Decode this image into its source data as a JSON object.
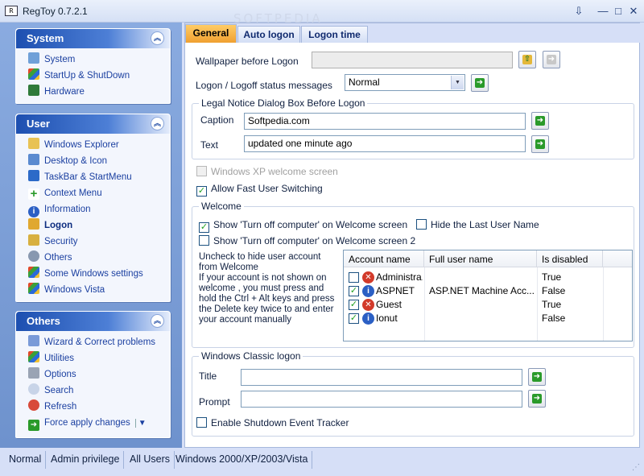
{
  "window": {
    "title": "RegToy 0.7.2.1",
    "watermark": "SOFTPEDIA"
  },
  "sidebar": {
    "system": {
      "title": "System",
      "items": [
        {
          "label": "System",
          "icon": "computer-icon"
        },
        {
          "label": "StartUp & ShutDown",
          "icon": "windows-flag-icon"
        },
        {
          "label": "Hardware",
          "icon": "circuit-board-icon"
        }
      ]
    },
    "user": {
      "title": "User",
      "items": [
        {
          "label": "Windows Explorer",
          "icon": "folder-icon"
        },
        {
          "label": "Desktop & Icon",
          "icon": "desktop-icon"
        },
        {
          "label": "TaskBar & StartMenu",
          "icon": "taskbar-icon"
        },
        {
          "label": "Context Menu",
          "icon": "plus-icon"
        },
        {
          "label": "Information",
          "icon": "info-icon"
        },
        {
          "label": "Logon",
          "icon": "key-icon"
        },
        {
          "label": "Security",
          "icon": "lock-icon"
        },
        {
          "label": "Others",
          "icon": "gear-icon"
        },
        {
          "label": "Some Windows settings",
          "icon": "windows-logo-icon"
        },
        {
          "label": "Windows Vista",
          "icon": "vista-logo-icon"
        }
      ]
    },
    "others": {
      "title": "Others",
      "items": [
        {
          "label": "Wizard & Correct problems",
          "icon": "wizard-icon"
        },
        {
          "label": "Utilities",
          "icon": "utilities-icon"
        },
        {
          "label": "Options",
          "icon": "tools-icon"
        },
        {
          "label": "Search",
          "icon": "magnifier-icon"
        },
        {
          "label": "Refresh",
          "icon": "refresh-icon"
        },
        {
          "label": "Force apply changes",
          "icon": "arrow-right-icon"
        }
      ]
    }
  },
  "tabs": [
    "General",
    "Auto logon",
    "Logon time"
  ],
  "general": {
    "wallpaper_label": "Wallpaper before Logon",
    "wallpaper_value": "",
    "status_label": "Logon / Logoff status messages",
    "status_value": "Normal",
    "legal_legend": "Legal Notice Dialog Box Before Logon",
    "caption_label": "Caption",
    "caption_value": "Softpedia.com",
    "text_label": "Text",
    "text_value": "updated one minute ago",
    "xp_welcome": "Windows XP welcome screen",
    "fast_switching": "Allow Fast User Switching"
  },
  "welcome": {
    "legend": "Welcome",
    "show_turn_off": "Show 'Turn off computer' on Welcome screen",
    "hide_last_user": "Hide the Last User Name",
    "show_turn_off_2": "Show 'Turn off computer' on Welcome screen 2",
    "note": "Uncheck to hide user account from Welcome\nIf your account is not shown on welcome , you must press and hold the Ctrl + Alt keys and press the Delete key twice to and enter your account manually",
    "columns": [
      "Account name",
      "Full user name",
      "Is disabled"
    ],
    "rows": [
      {
        "checked": false,
        "icon": "error-icon",
        "account": "Administra...",
        "full_name": "",
        "disabled": "True"
      },
      {
        "checked": true,
        "icon": "info-icon",
        "account": "ASPNET",
        "full_name": "ASP.NET Machine Acc...",
        "disabled": "False"
      },
      {
        "checked": true,
        "icon": "error-icon",
        "account": "Guest",
        "full_name": "",
        "disabled": "True"
      },
      {
        "checked": true,
        "icon": "info-icon",
        "account": "Ionut",
        "full_name": "",
        "disabled": "False"
      }
    ]
  },
  "classic": {
    "legend": "Windows Classic logon",
    "title_label": "Title",
    "title_value": "",
    "prompt_label": "Prompt",
    "prompt_value": "",
    "shutdown_tracker": "Enable Shutdown Event Tracker"
  },
  "statusbar": [
    "Normal",
    "Admin privilege",
    "All Users",
    "Windows 2000/XP/2003/Vista"
  ],
  "colors": {
    "accent": "#1d4fb0",
    "tab_active": "#f0a030",
    "go_green": "#2a9a2a"
  }
}
